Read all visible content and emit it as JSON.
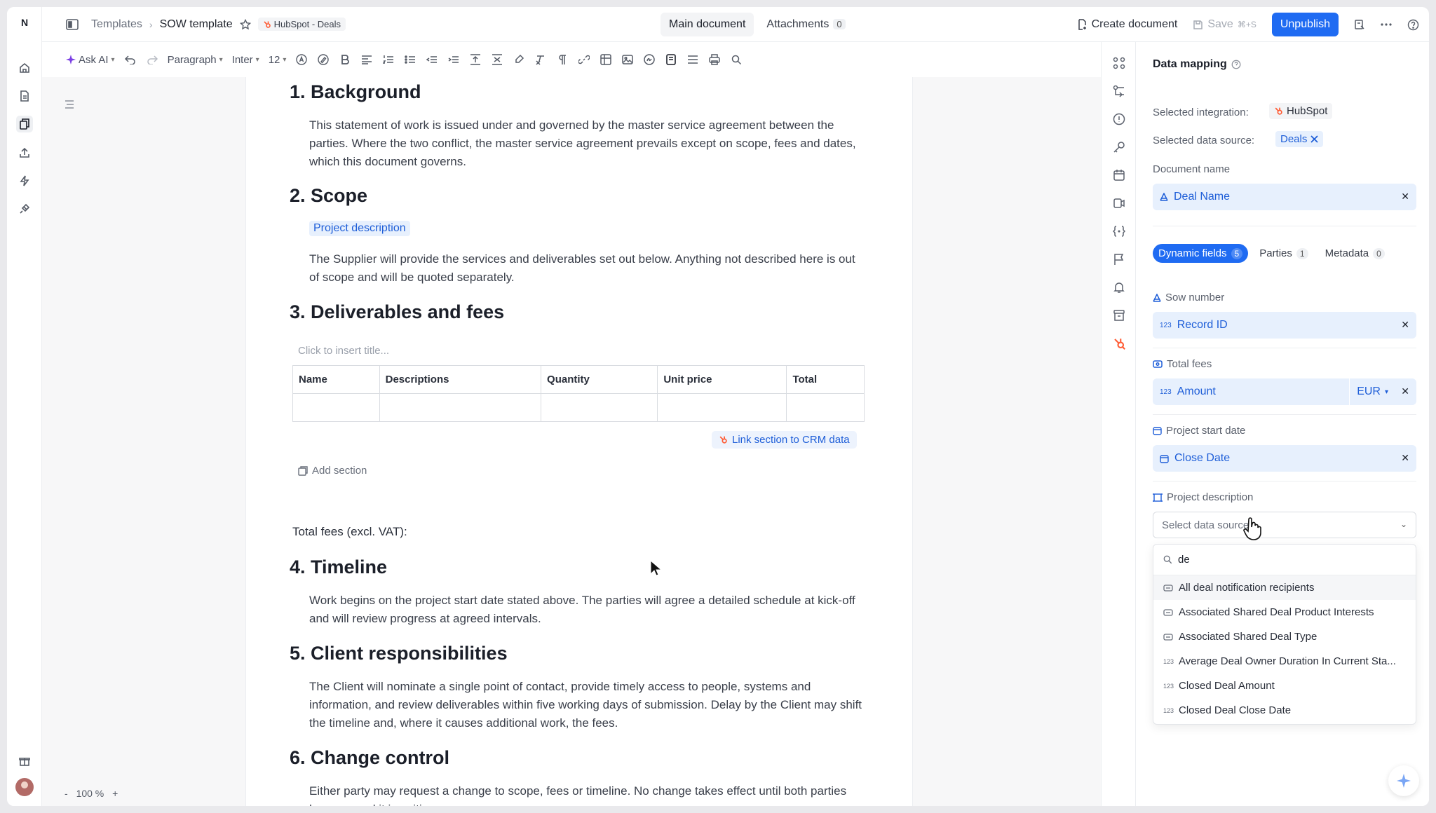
{
  "app": {
    "logo_letter": "N"
  },
  "breadcrumb": {
    "root": "Templates",
    "current": "SOW template",
    "tag": "HubSpot - Deals"
  },
  "center_tabs": [
    {
      "label": "Main document",
      "active": true
    },
    {
      "label": "Attachments",
      "count": "0",
      "active": false
    }
  ],
  "top_actions": {
    "create": "Create document",
    "save": "Save",
    "save_shortcut": "⌘+S",
    "unpublish": "Unpublish"
  },
  "toolbar": {
    "ask_ai": "Ask AI",
    "paragraph": "Paragraph",
    "font": "Inter",
    "size": "12"
  },
  "document": {
    "sections": [
      {
        "title": "1. Background",
        "body": "This statement of work is issued under and governed by the master service agreement between the parties. Where the two conflict, the master service agreement prevails except on scope, fees and dates, which this document governs."
      },
      {
        "title": "2. Scope",
        "chip": "Project description",
        "body": "The Supplier will provide the services and deliverables set out below. Anything not described here is out of scope and will be quoted separately."
      },
      {
        "title": "3. Deliverables and fees",
        "table_title_placeholder": "Click to insert title...",
        "columns": [
          "Name",
          "Descriptions",
          "Quantity",
          "Unit price",
          "Total"
        ]
      },
      {
        "title": "4. Timeline",
        "body": "Work begins on the project start date stated above. The parties will agree a detailed schedule at kick-off and will review progress at agreed intervals."
      },
      {
        "title": "5. Client responsibilities",
        "body": "The Client will nominate a single point of contact, provide timely access to people, systems and information, and review deliverables within five working days of submission. Delay by the Client may shift the timeline and, where it causes additional work, the fees."
      },
      {
        "title": "6. Change control",
        "body": "Either party may request a change to scope, fees or timeline. No change takes effect until both parties have agreed it in writing."
      }
    ],
    "link_crm": "Link section to CRM data",
    "add_section": "Add section",
    "total_fees_label": "Total fees (excl. VAT):"
  },
  "zoom": {
    "minus": "-",
    "value": "100 %",
    "plus": "+"
  },
  "panel": {
    "title": "Data mapping",
    "selected_integration_label": "Selected integration:",
    "selected_integration": "HubSpot",
    "selected_source_label": "Selected data source:",
    "selected_source": "Deals",
    "document_name_label": "Document name",
    "document_name_value": "Deal Name",
    "tabs": [
      {
        "label": "Dynamic fields",
        "count": "5",
        "active": true
      },
      {
        "label": "Parties",
        "count": "1",
        "active": false
      },
      {
        "label": "Metadata",
        "count": "0",
        "active": false
      }
    ],
    "fields": [
      {
        "label": "Sow number",
        "value": "Record ID"
      },
      {
        "label": "Total fees",
        "value": "Amount",
        "currency": "EUR"
      },
      {
        "label": "Project start date",
        "value": "Close Date"
      },
      {
        "label": "Project description",
        "placeholder": "Select data source"
      }
    ],
    "search_query": "de",
    "options": [
      "All deal notification recipients",
      "Associated Shared Deal Product Interests",
      "Associated Shared Deal Type",
      "Average Deal Owner Duration In Current Sta...",
      "Closed Deal Amount",
      "Closed Deal Close Date"
    ]
  },
  "colors": {
    "accent": "#1f6bf2",
    "chip_bg": "#e7f0fd",
    "chip_text": "#1e5ed8",
    "hubspot": "#ff5c35"
  }
}
